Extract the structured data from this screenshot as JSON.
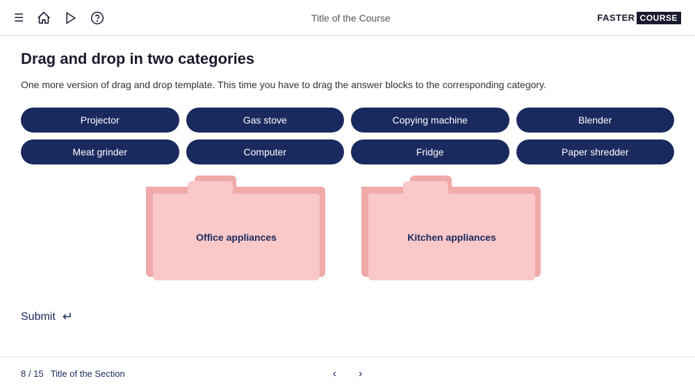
{
  "header": {
    "title": "Title of the Course",
    "brand_faster": "FASTER",
    "brand_course": "COURSE"
  },
  "page": {
    "title": "Drag and drop in two categories",
    "description": "One more version of drag and drop template. This time you have to drag the answer blocks\nto the corresponding category."
  },
  "drag_items": [
    {
      "id": "projector",
      "label": "Projector"
    },
    {
      "id": "gas-stove",
      "label": "Gas stove"
    },
    {
      "id": "copying-machine",
      "label": "Copying machine"
    },
    {
      "id": "blender",
      "label": "Blender"
    },
    {
      "id": "meat-grinder",
      "label": "Meat grinder"
    },
    {
      "id": "computer",
      "label": "Computer"
    },
    {
      "id": "fridge",
      "label": "Fridge"
    },
    {
      "id": "paper-shredder",
      "label": "Paper shredder"
    }
  ],
  "drop_zones": [
    {
      "id": "office",
      "label": "Office appliances"
    },
    {
      "id": "kitchen",
      "label": "Kitchen appliances"
    }
  ],
  "footer": {
    "page_current": "8",
    "page_total": "15",
    "section_title": "Title of the Section",
    "submit_label": "Submit"
  },
  "icons": {
    "menu": "☰",
    "home": "⌂",
    "play": "▷",
    "help": "?",
    "enter": "↵",
    "prev": "‹",
    "next": "›"
  }
}
